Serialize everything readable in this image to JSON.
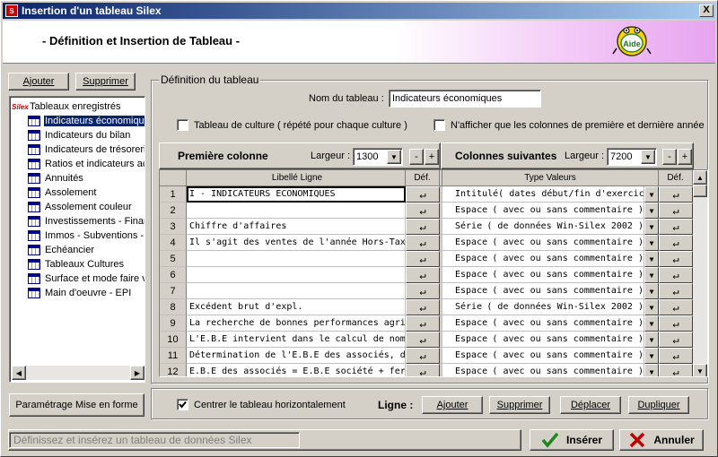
{
  "window": {
    "title": "Insertion d'un tableau Silex",
    "close": "X"
  },
  "header": {
    "title": "- Définition et Insertion de Tableau -",
    "aide_label": "Aide"
  },
  "left": {
    "ajouter": "Ajouter",
    "supprimer": "Supprimer",
    "tree_root": "Tableaux enregistrés",
    "tree_items": [
      "Indicateurs économiques",
      "Indicateurs du bilan",
      "Indicateurs de trésorerie",
      "Ratios et indicateurs ac",
      "Annuités",
      "Assolement",
      "Assolement couleur",
      "Investissements - Financ",
      "Immos - Subventions - E",
      "Echéancier",
      "Tableaux Cultures",
      "Surface et mode faire va",
      "Main d'oeuvre - EPI"
    ],
    "parametrage": "Paramétrage Mise en forme"
  },
  "definition": {
    "group_title": "Définition du tableau",
    "nom_label": "Nom du tableau :",
    "nom_value": "Indicateurs économiques",
    "culture_label": "Tableau de culture ( répété pour chaque culture )",
    "afficher_label": "N'afficher que les colonnes de première et dernière année",
    "premiere_colonne": "Première colonne",
    "colonnes_suivantes": "Colonnes suivantes",
    "largeur_label": "Largeur :",
    "largeur1": "1300",
    "largeur2": "7200",
    "minus": "-",
    "plus": "+",
    "col_libelle": "Libellé Ligne",
    "col_def": "Déf.",
    "col_type": "Type Valeurs",
    "def_icon": "↵",
    "rows": [
      {
        "n": "1",
        "libelle": "I - INDICATEURS ECONOMIQUES",
        "type": "Intitulé",
        "detail": "( dates début/fin d'exercice )"
      },
      {
        "n": "2",
        "libelle": "",
        "type": "Espace",
        "detail": "( avec ou sans commentaire )"
      },
      {
        "n": "3",
        "libelle": "Chiffre d'affaires",
        "type": "Série",
        "detail": "( de données Win-Silex 2002 )"
      },
      {
        "n": "4",
        "libelle": "Il s'agit des ventes de l'année Hors-Taxes",
        "type": "Espace",
        "detail": "( avec ou sans commentaire )"
      },
      {
        "n": "5",
        "libelle": "",
        "type": "Espace",
        "detail": "( avec ou sans commentaire )"
      },
      {
        "n": "6",
        "libelle": "",
        "type": "Espace",
        "detail": "( avec ou sans commentaire )"
      },
      {
        "n": "7",
        "libelle": "",
        "type": "Espace",
        "detail": "( avec ou sans commentaire )"
      },
      {
        "n": "8",
        "libelle": "Excédent brut d'expl.",
        "type": "Série",
        "detail": "( de données Win-Silex 2002 )"
      },
      {
        "n": "9",
        "libelle": "La recherche de bonnes performances agricoles",
        "type": "Espace",
        "detail": "( avec ou sans commentaire )"
      },
      {
        "n": "10",
        "libelle": "L'E.B.E intervient dans le calcul de nombreux ra",
        "type": "Espace",
        "detail": "( avec ou sans commentaire )"
      },
      {
        "n": "11",
        "libelle": "Détermination de l'E.B.E des associés, dans not",
        "type": "Espace",
        "detail": "( avec ou sans commentaire )"
      },
      {
        "n": "12",
        "libelle": "E.B.E des associés = E.B.E société + fermage p",
        "type": "Espace",
        "detail": "( avec ou sans commentaire )"
      }
    ]
  },
  "bottom": {
    "centrer_label": "Centrer le tableau horizontalement",
    "ligne_label": "Ligne :",
    "ajouter": "Ajouter",
    "supprimer": "Supprimer",
    "deplacer": "Déplacer",
    "dupliquer": "Dupliquer"
  },
  "status": {
    "text": "Définissez et insérez un tableau de données Silex"
  },
  "actions": {
    "inserer": "Insérer",
    "annuler": "Annuler"
  },
  "colors": {
    "title_start": "#0a246a",
    "title_end": "#a6caf0",
    "selection": "#0a246a",
    "header_gradient": "#e6a4ef",
    "ok_green": "#1a8a1a",
    "cancel_red": "#c00000"
  }
}
